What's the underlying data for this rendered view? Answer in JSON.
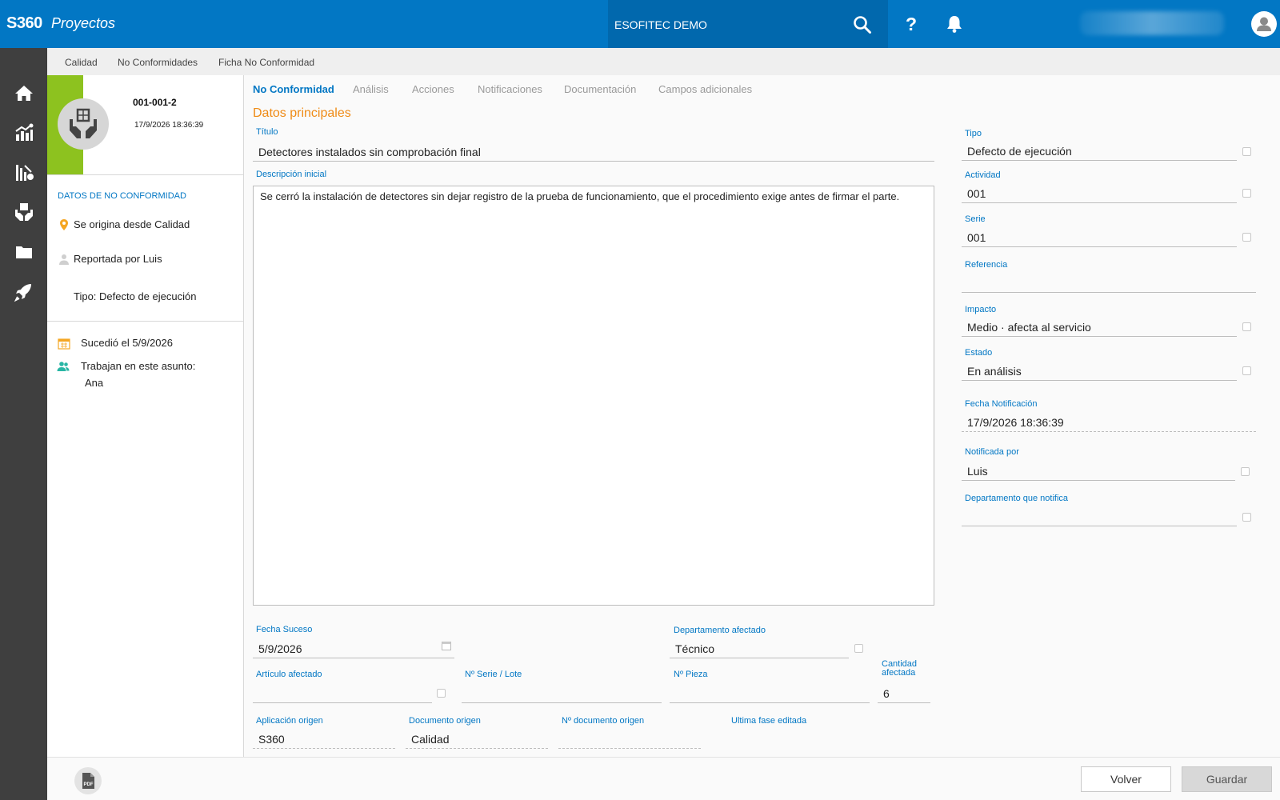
{
  "header": {
    "brand": "S360",
    "module": "Proyectos",
    "company": "ESOFITEC DEMO",
    "help": "?"
  },
  "breadcrumb": [
    "Calidad",
    "No Conformidades",
    "Ficha No Conformidad"
  ],
  "record": {
    "code": "001-001-2",
    "datetime": "17/9/2026 18:36:39"
  },
  "info": {
    "section_title": "DATOS DE NO CONFORMIDAD",
    "origin": "Se origina desde Calidad",
    "reported_by": "Reportada por Luis",
    "type": "Tipo: Defecto de ejecución",
    "happened": "Sucedió el 5/9/2026",
    "working_label": "Trabajan en este asunto:",
    "working_people": "Ana"
  },
  "tabs": [
    "No Conformidad",
    "Análisis",
    "Acciones",
    "Notificaciones",
    "Documentación",
    "Campos adicionales"
  ],
  "main": {
    "section_header": "Datos principales",
    "titulo_label": "Título",
    "titulo_value": "Detectores instalados sin comprobación final",
    "descripcion_label": "Descripción inicial",
    "descripcion_value": "Se cerró la instalación de detectores sin dejar registro de la prueba de funcionamiento, que el procedimiento exige antes de firmar el parte.",
    "fecha_suceso_label": "Fecha Suceso",
    "fecha_suceso_value": "5/9/2026",
    "depto_afectado_label": "Departamento afectado",
    "depto_afectado_value": "Técnico",
    "articulo_label": "Artículo afectado",
    "articulo_value": "",
    "serie_lote_label": "Nº Serie / Lote",
    "serie_lote_value": "",
    "pieza_label": "Nº Pieza",
    "pieza_value": "",
    "cantidad_label": "Cantidad afectada",
    "cantidad_value": "6",
    "app_origen_label": "Aplicación origen",
    "app_origen_value": "S360",
    "doc_origen_label": "Documento origen",
    "doc_origen_value": "Calidad",
    "num_doc_origen_label": "Nº documento origen",
    "num_doc_origen_value": "",
    "ultima_fase_label": "Ultima fase editada",
    "ultima_fase_value": ""
  },
  "side": {
    "tipo_label": "Tipo",
    "tipo_value": "Defecto de ejecución",
    "actividad_label": "Actividad",
    "actividad_value": "001",
    "serie_label": "Serie",
    "serie_value": "001",
    "referencia_label": "Referencia",
    "referencia_value": "",
    "impacto_label": "Impacto",
    "impacto_value": "Medio · afecta al servicio",
    "estado_label": "Estado",
    "estado_value": "En análisis",
    "fecha_notif_label": "Fecha Notificación",
    "fecha_notif_value": "17/9/2026 18:36:39",
    "notificada_por_label": "Notificada por",
    "notificada_por_value": "Luis",
    "depto_notifica_label": "Departamento que notifica",
    "depto_notifica_value": ""
  },
  "footer": {
    "back_label": "Volver",
    "save_label": "Guardar",
    "pdf_label": "PDF"
  },
  "colors": {
    "primary": "#0277c4",
    "topbar_dark": "#0168ad",
    "accent_orange": "#ef8b16",
    "green_strip": "#8dc21f",
    "sidebar": "#3f3f3f"
  }
}
